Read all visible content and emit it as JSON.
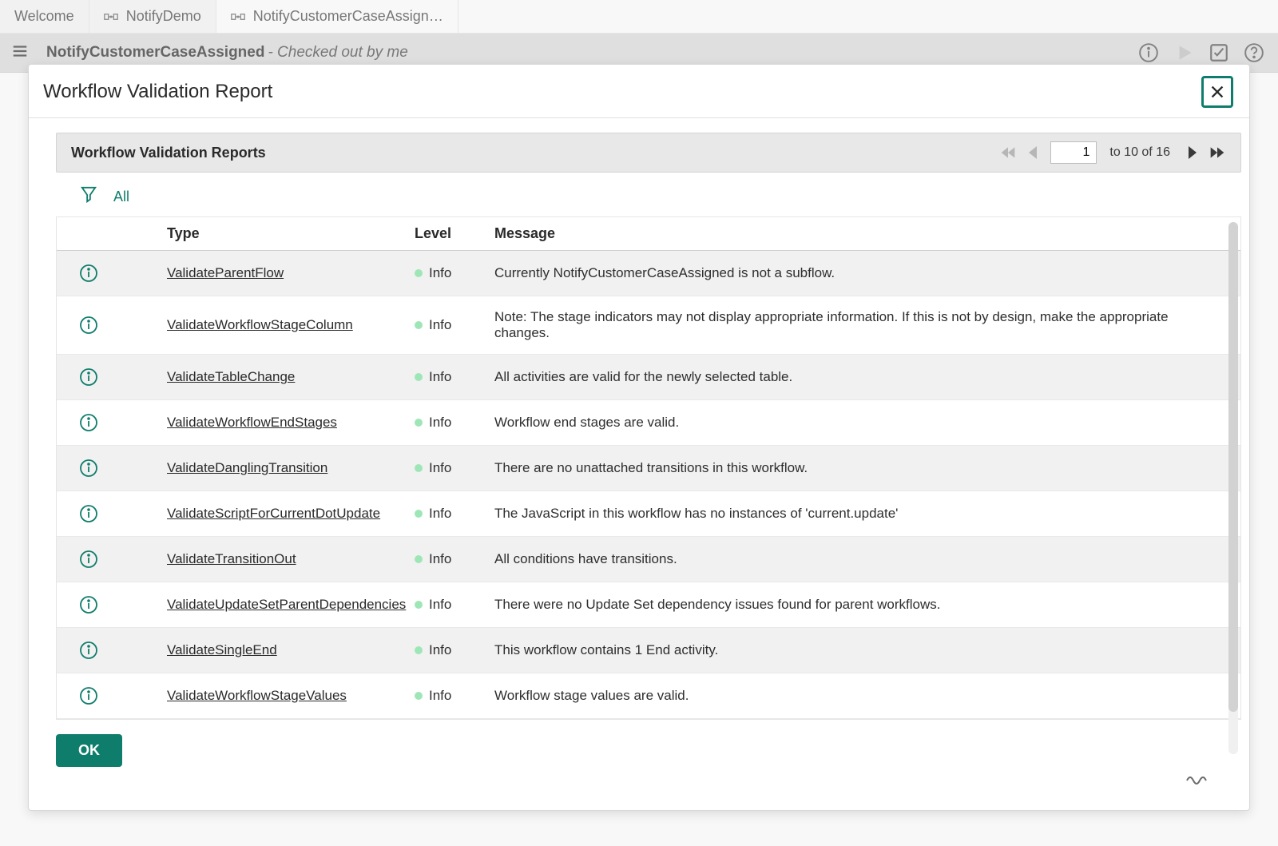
{
  "tabs": [
    {
      "label": "Welcome",
      "hasIcon": false
    },
    {
      "label": "NotifyDemo",
      "hasIcon": true
    },
    {
      "label": "NotifyCustomerCaseAssign…",
      "hasIcon": true,
      "active": true
    }
  ],
  "toolbar": {
    "title": "NotifyCustomerCaseAssigned",
    "status": "- Checked out by me"
  },
  "dialog": {
    "title": "Workflow Validation Report",
    "subheader": "Workflow Validation Reports",
    "filter_all": "All",
    "ok": "OK",
    "pager": {
      "page": "1",
      "range": "to 10 of 16"
    },
    "columns": {
      "type": "Type",
      "level": "Level",
      "message": "Message"
    },
    "rows": [
      {
        "type": "ValidateParentFlow",
        "level": "Info",
        "message": "Currently NotifyCustomerCaseAssigned is not a subflow."
      },
      {
        "type": "ValidateWorkflowStageColumn",
        "level": "Info",
        "message": "Note: The stage indicators may not display appropriate information. If this is not by design, make the appropriate changes."
      },
      {
        "type": "ValidateTableChange",
        "level": "Info",
        "message": "All activities are valid for the newly selected table."
      },
      {
        "type": "ValidateWorkflowEndStages",
        "level": "Info",
        "message": "Workflow end stages are valid."
      },
      {
        "type": "ValidateDanglingTransition",
        "level": "Info",
        "message": "There are no unattached transitions in this workflow."
      },
      {
        "type": "ValidateScriptForCurrentDotUpdate",
        "level": "Info",
        "message": "The JavaScript in this workflow has no instances of 'current.update'"
      },
      {
        "type": "ValidateTransitionOut",
        "level": "Info",
        "message": "All conditions have transitions."
      },
      {
        "type": "ValidateUpdateSetParentDependencies",
        "level": "Info",
        "message": "There were no Update Set dependency issues found for parent workflows."
      },
      {
        "type": "ValidateSingleEnd",
        "level": "Info",
        "message": "This workflow contains 1 End activity."
      },
      {
        "type": "ValidateWorkflowStageValues",
        "level": "Info",
        "message": "Workflow stage values are valid."
      }
    ]
  }
}
